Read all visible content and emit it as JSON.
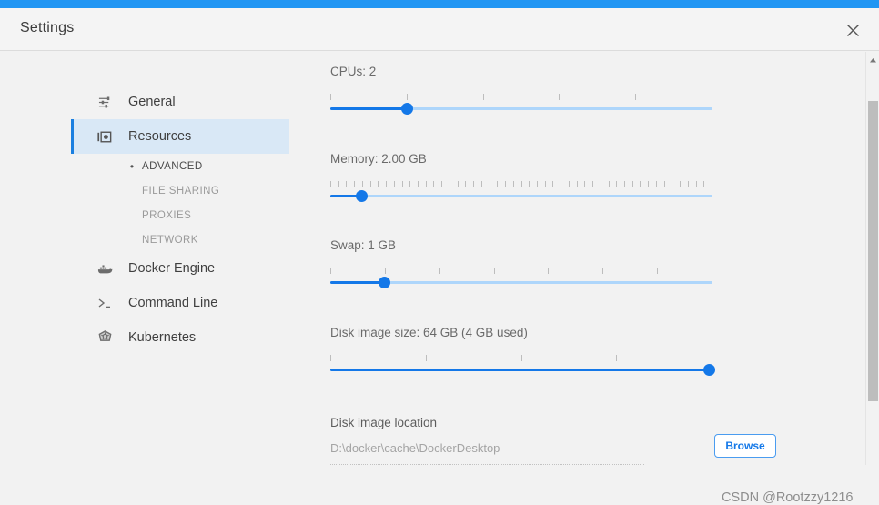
{
  "window": {
    "title": "Settings",
    "close_icon": "close-icon",
    "accent_color": "#2196f3"
  },
  "sidebar": {
    "items": [
      {
        "label": "General",
        "icon": "sliders-icon",
        "active": false
      },
      {
        "label": "Resources",
        "icon": "resources-icon",
        "active": true
      },
      {
        "label": "Docker Engine",
        "icon": "docker-whale-icon",
        "active": false
      },
      {
        "label": "Command Line",
        "icon": "terminal-prompt-icon",
        "active": false
      },
      {
        "label": "Kubernetes",
        "icon": "kubernetes-helm-icon",
        "active": false
      }
    ],
    "sub_items": [
      {
        "label": "ADVANCED",
        "current": true
      },
      {
        "label": "FILE SHARING",
        "current": false
      },
      {
        "label": "PROXIES",
        "current": false
      },
      {
        "label": "NETWORK",
        "current": false
      }
    ]
  },
  "main": {
    "sliders": [
      {
        "name": "cpus",
        "label": "CPUs: 2",
        "value": 2,
        "percent": 20,
        "tick_count": 6
      },
      {
        "name": "memory",
        "label": "Memory: 2.00 GB",
        "value": "2.00 GB",
        "percent": 8,
        "tick_count": 49
      },
      {
        "name": "swap",
        "label": "Swap: 1 GB",
        "value": "1 GB",
        "percent": 14,
        "tick_count": 8
      },
      {
        "name": "disk-image-size",
        "label": "Disk image size: 64 GB (4 GB used)",
        "value": "64 GB",
        "used": "4 GB",
        "percent": 99,
        "tick_count": 5
      }
    ],
    "disk_location": {
      "title": "Disk image location",
      "path": "D:\\docker\\cache\\DockerDesktop",
      "browse_label": "Browse"
    }
  },
  "watermark": "CSDN @Rootzzy1216",
  "scrollbar": {
    "up_arrow_icon": "triangle-up-icon"
  }
}
